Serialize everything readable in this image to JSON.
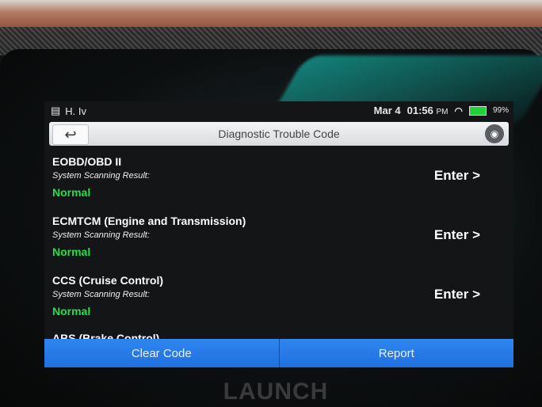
{
  "status": {
    "left_icons": [
      "calendar-icon",
      "notification-icon"
    ],
    "left_text": "H. Iv",
    "date": "Mar 4",
    "time": "01:56",
    "ampm": "PM",
    "battery": "99%"
  },
  "title_bar": {
    "title": "Diagnostic Trouble Code"
  },
  "systems": [
    {
      "name": "EOBD/OBD II",
      "sub": "System Scanning Result:",
      "status": "Normal",
      "enter": "Enter >"
    },
    {
      "name": "ECMTCM (Engine and Transmission)",
      "sub": "System Scanning Result:",
      "status": "Normal",
      "enter": "Enter >"
    },
    {
      "name": "CCS (Cruise Control)",
      "sub": "System Scanning Result:",
      "status": "Normal",
      "enter": "Enter >"
    },
    {
      "name": "ABS (Brake Control)",
      "sub": "",
      "status": "",
      "enter": ""
    }
  ],
  "bottom": {
    "clear_label": "Clear Code",
    "report_label": "Report"
  },
  "device_brand": "LAUNCH",
  "colors": {
    "accent": "#1f6fe0",
    "normal_status": "#22e04a"
  }
}
